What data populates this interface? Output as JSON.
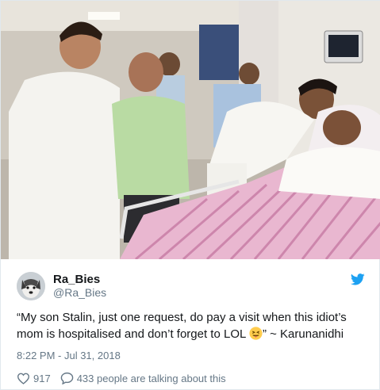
{
  "tweet": {
    "display_name": "Ra_Bies",
    "handle": "@Ra_Bies",
    "text_before_emoji": "“My son Stalin, just one request, do pay a visit when this idiot’s mom is hospitalised and don’t forget to LOL ",
    "text_after_emoji": "” ~ Karunanidhi",
    "timestamp": "8:22 PM - Jul 31, 2018",
    "like_count": "917",
    "conversation_text": "433 people are talking about this"
  },
  "colors": {
    "text_primary": "#14171a",
    "text_secondary": "#657786",
    "twitter_blue": "#1da1f2",
    "like_red": "#657786"
  },
  "icons": {
    "brand": "twitter-bird-icon",
    "like": "heart-icon",
    "reply": "speech-bubble-icon",
    "emoji": "winking-tongue-emoji-icon"
  }
}
